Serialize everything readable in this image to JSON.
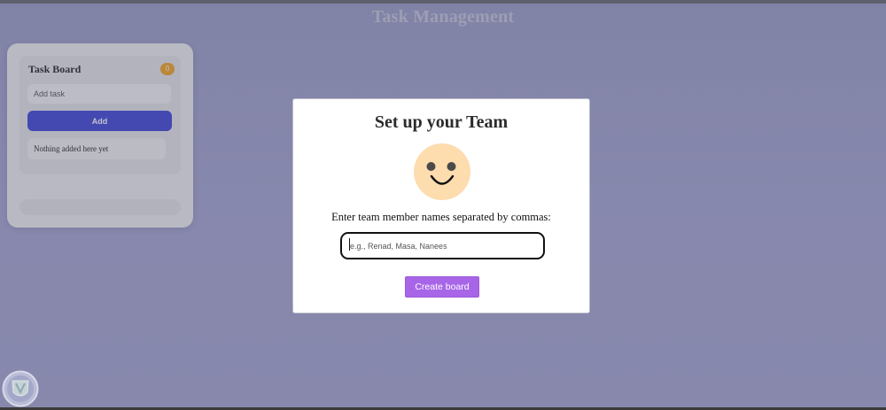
{
  "header": {
    "title": "Task Management"
  },
  "board": {
    "title": "Task Board",
    "count": "0",
    "input_placeholder": "Add task",
    "add_label": "Add",
    "empty_text": "Nothing added here yet"
  },
  "modal": {
    "title": "Set up your Team",
    "avatar_icon": "smiley-face-icon",
    "label": "Enter team member names separated by commas:",
    "input_placeholder": "e.g., Renad, Masa, Nanees",
    "input_value": "",
    "create_label": "Create board"
  },
  "colors": {
    "accent_button": "#a865e8",
    "board_add_button": "#3d45d9",
    "count_badge": "#f5a623",
    "smiley_face": "#fddcae"
  },
  "logo": {
    "icon": "shield-logo-icon"
  }
}
